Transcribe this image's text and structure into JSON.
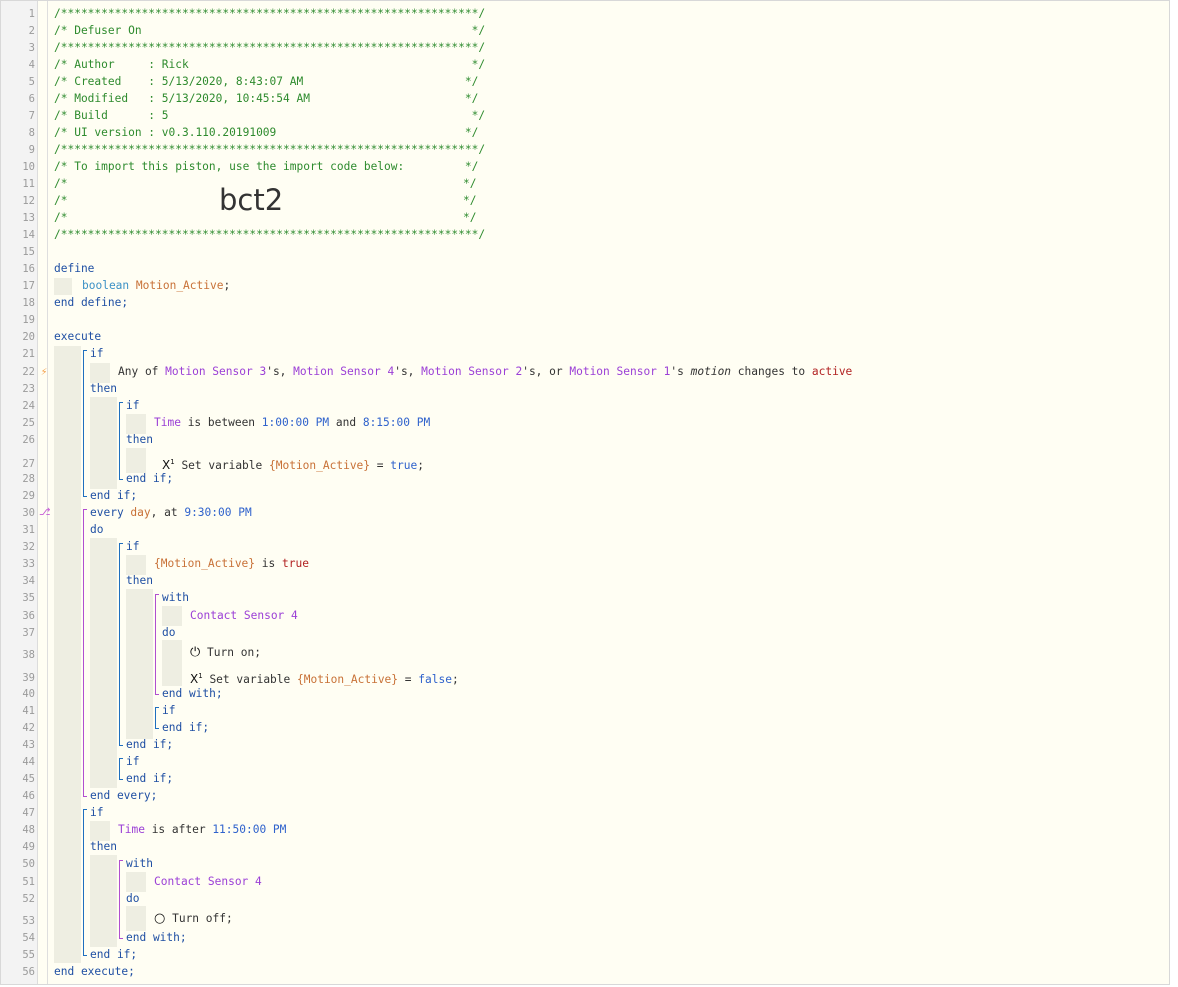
{
  "line_numbers": [
    "1",
    "2",
    "3",
    "4",
    "5",
    "6",
    "7",
    "8",
    "9",
    "10",
    "11",
    "12",
    "13",
    "14",
    "15",
    "16",
    "17",
    "18",
    "19",
    "20",
    "21",
    "22",
    "23",
    "24",
    "25",
    "26",
    "27",
    "28",
    "29",
    "30",
    "31",
    "32",
    "33",
    "34",
    "35",
    "36",
    "37",
    "38",
    "39",
    "40",
    "41",
    "42",
    "43",
    "44",
    "45",
    "46",
    "47",
    "48",
    "49",
    "50",
    "51",
    "52",
    "53",
    "54",
    "55",
    "56"
  ],
  "header": {
    "border": "/**************************************************************/",
    "title": "/* Defuser On                                                 */",
    "author": "/* Author     : Rick                                          */",
    "created": "/* Created    : 5/13/2020, 8:43:07 AM                        */",
    "modified": "/* Modified   : 5/13/2020, 10:45:54 AM                       */",
    "build": "/* Build      : 5                                             */",
    "ui_version": "/* UI version : v0.3.110.20191009                            */",
    "import_note": "/* To import this piston, use the import code below:         */",
    "blank_open": "/*",
    "blank_close": "*/",
    "import_code": "bct2"
  },
  "define": {
    "keyword": "define",
    "var_type": "boolean",
    "var_name": "Motion_Active",
    "semicolon": ";",
    "end": "end define;"
  },
  "execute": {
    "keyword": "execute",
    "end": "end execute;"
  },
  "kw": {
    "if": "if",
    "then": "then",
    "end_if": "end if;",
    "do": "do",
    "with": "with",
    "end_with": "end with;",
    "end_every": "end every;"
  },
  "trigger": {
    "any_of": "Any of ",
    "sensor3": "Motion Sensor 3",
    "sep1": "'s, ",
    "sensor4": "Motion Sensor 4",
    "sep2": "'s, ",
    "sensor2": "Motion Sensor 2",
    "sep3": "'s, or ",
    "sensor1": "Motion Sensor 1",
    "sep4": "'s ",
    "attr": "motion",
    "changes": " changes to ",
    "value": "active",
    "icon": "lightning-bolt-icon"
  },
  "time_cond": {
    "time": "Time",
    "between": " is between ",
    "start": "1:00:00 PM",
    "and": " and ",
    "end": "8:15:00 PM"
  },
  "set_true": {
    "icon_text": "X",
    "icon_sup": "1",
    "label": " Set variable ",
    "var": "{Motion_Active}",
    "eq": " = ",
    "value": "true",
    "semi": ";"
  },
  "every": {
    "every": "every ",
    "day": "day",
    "at": ", at ",
    "time": "9:30:00 PM",
    "icon": "timer-branch-icon"
  },
  "is_true": {
    "var": "{Motion_Active}",
    "is": " is ",
    "value": "true"
  },
  "contact_device": "Contact Sensor 4",
  "turn_on": {
    "icon": "⏻",
    "label": "Turn on;"
  },
  "set_false": {
    "icon_text": "X",
    "icon_sup": "1",
    "label": " Set variable ",
    "var": "{Motion_Active}",
    "eq": " = ",
    "value": "false",
    "semi": ";"
  },
  "after_cond": {
    "time": "Time",
    "after": " is after ",
    "value": "11:50:00 PM"
  },
  "turn_off": {
    "icon": "○",
    "label": "Turn off;"
  },
  "colors": {
    "comment": "#2e8b2e",
    "keyword": "#1f4fa3",
    "device": "#9b3fd6",
    "variable": "#c87137",
    "value": "#b22222",
    "literal": "#2f62cc",
    "background": "#fffef3"
  }
}
